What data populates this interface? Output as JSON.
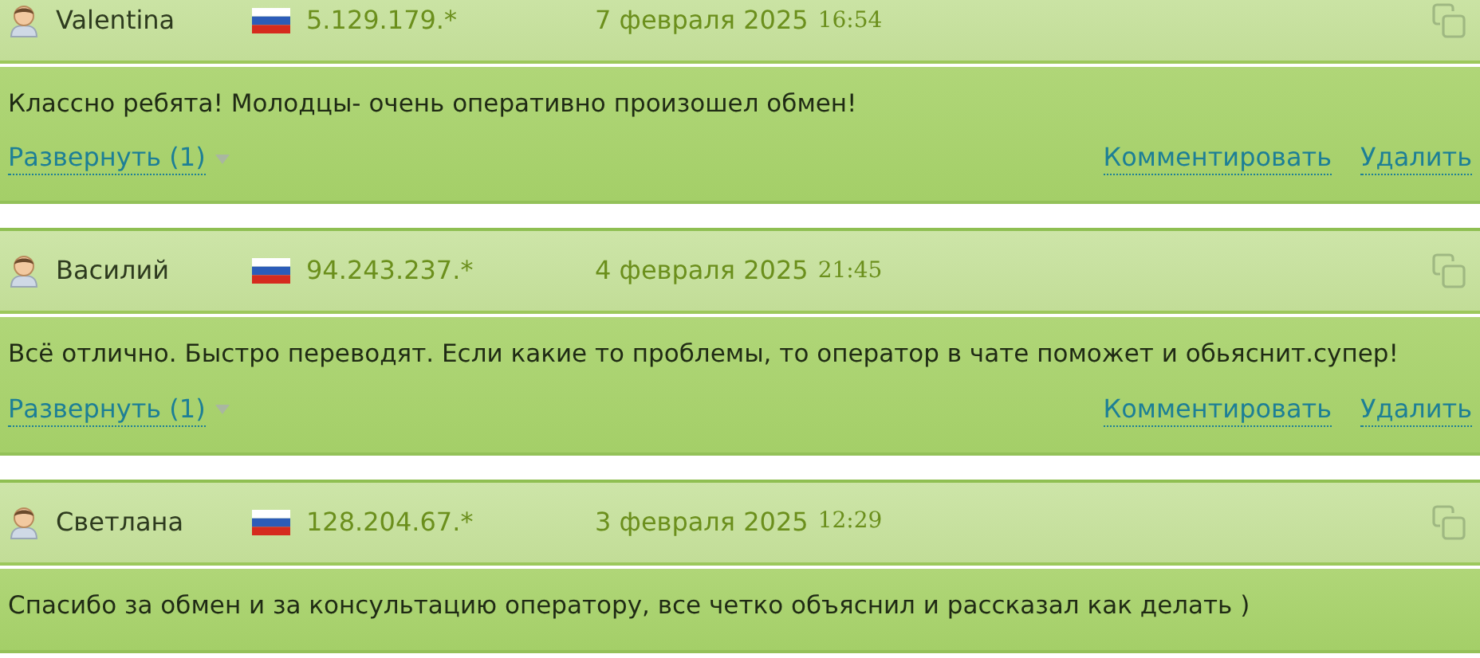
{
  "reviews": [
    {
      "author": "Valentina",
      "ip": "5.129.179.*",
      "date": "7 февраля 2025",
      "time": "16:54",
      "text": "Классно ребята! Молодцы- очень оперативно произошел обмен!",
      "expand": "Развернуть (1)",
      "actions": [
        "Комментировать",
        "Удалить"
      ]
    },
    {
      "author": "Василий",
      "ip": "94.243.237.*",
      "date": "4 февраля 2025",
      "time": "21:45",
      "text": "Всё отлично. Быстро переводят. Если какие то проблемы, то оператор в чате поможет и обьяснит.супер!",
      "expand": "Развернуть (1)",
      "actions": [
        "Комментировать",
        "Удалить"
      ]
    },
    {
      "author": "Светлана",
      "ip": "128.204.67.*",
      "date": "3 февраля 2025",
      "time": "12:29",
      "text": "Спасибо за обмен и за консультацию оператору, все четко объяснил и рассказал как делать )"
    }
  ]
}
